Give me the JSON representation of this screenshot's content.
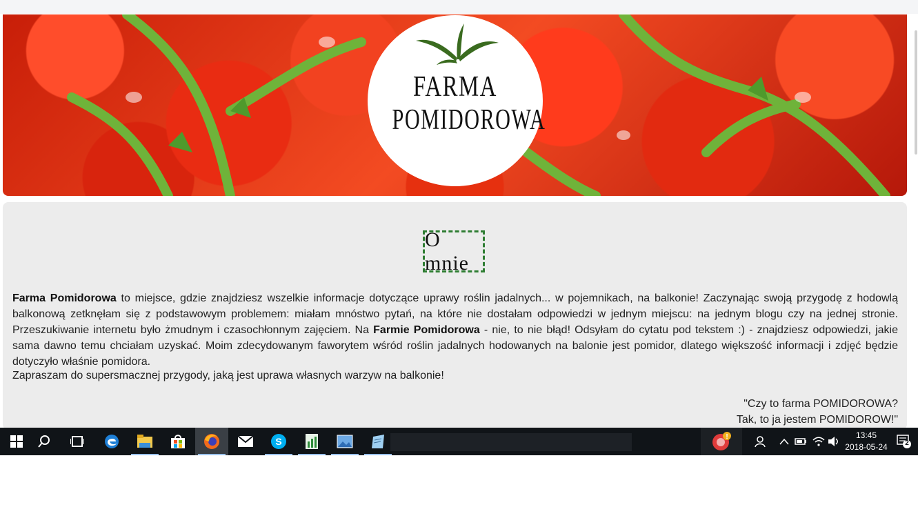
{
  "logo": {
    "line1": "FARMA",
    "line2": "POMIDOROWA"
  },
  "section": {
    "title": "O mnie"
  },
  "about": {
    "brand1": "Farma Pomidorowa",
    "text1": " to miejsce, gdzie znajdziesz wszelkie informacje dotyczące uprawy roślin jadalnych... w pojemnikach, na balkonie! Zaczynając swoją przygodę z hodowlą balkonową zetknęłam się z podstawowym problemem: miałam mnóstwo pytań, na które nie dostałam odpowiedzi w jednym miejscu: na jednym blogu czy na jednej stronie. Przeszukiwanie internetu było żmudnym i czasochłonnym zajęciem. Na ",
    "brand2": "Farmie Pomidorowa",
    "text2": " - nie, to nie błąd! Odsyłam do cytatu pod tekstem :) - znajdziesz odpowiedzi, jakie sama dawno temu chciałam uzyskać. Moim zdecydowanym faworytem wśród roślin jadalnych hodowanych na balonie jest pomidor, dlatego większość informacji i zdjęć będzie dotyczyło właśnie pomidora.",
    "invite": "Zapraszam do supersmacznej przygody, jaką jest uprawa własnych warzyw na balkonie!"
  },
  "quote": {
    "line1": "\"Czy to farma POMIDOROWA?",
    "line2": "Tak, to ja jestem POMIDOROW!\""
  },
  "taskbar": {
    "apps": [
      "start-icon",
      "search-icon",
      "task-view-icon",
      "edge-icon",
      "file-explorer-icon",
      "store-icon",
      "firefox-icon",
      "mail-icon",
      "skype-icon",
      "spreadsheet-icon",
      "photos-icon",
      "notepad-icon"
    ],
    "time": "13:45",
    "date": "2018-05-24",
    "notifications": "2"
  },
  "colors": {
    "accent_dashed": "#2e7d32",
    "content_bg": "#ececec",
    "taskbar_bg": "#101418"
  }
}
